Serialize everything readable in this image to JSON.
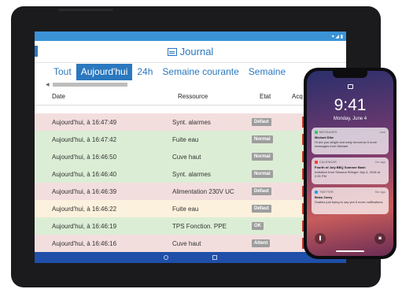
{
  "app": {
    "title": "Journal"
  },
  "tabs": [
    "Tout",
    "Aujourd'hui",
    "24h",
    "Semaine courante",
    "Semaine"
  ],
  "active_tab": 1,
  "table": {
    "headers": {
      "date": "Date",
      "resource": "Ressource",
      "state": "Etat",
      "ack": "Acq"
    },
    "rows": [
      {
        "date": "Aujourd'hui, à 16:47:49",
        "resource": "Synt. alarmes",
        "state": "Défaut",
        "bg": "#f3dede",
        "ack": true
      },
      {
        "date": "Aujourd'hui, à 16:47:42",
        "resource": "Fuite eau",
        "state": "Normal",
        "bg": "#dbeed5",
        "ack": true
      },
      {
        "date": "Aujourd'hui, à 16:46:50",
        "resource": "Cuve haut",
        "state": "Normal",
        "bg": "#dbeed5",
        "ack": true
      },
      {
        "date": "Aujourd'hui, à 16:46:40",
        "resource": "Synt. alarmes",
        "state": "Normal",
        "bg": "#dbeed5",
        "ack": true
      },
      {
        "date": "Aujourd'hui, à 16:46:39",
        "resource": "Alimentation 230V UC",
        "state": "Défaut",
        "bg": "#f3dede",
        "ack": true
      },
      {
        "date": "Aujourd'hui, à 16:46:22",
        "resource": "Fuite eau",
        "state": "Défaut",
        "bg": "#fbf1dc",
        "ack": true
      },
      {
        "date": "Aujourd'hui, à 16:46:19",
        "resource": "TPS Fonction. PPE",
        "state": "OK",
        "bg": "#dbeed5",
        "ack": true
      },
      {
        "date": "Aujourd'hui, à 16:46:16",
        "resource": "Cuve haut",
        "state": "Attent",
        "bg": "#f3dede",
        "ack": true
      }
    ]
  },
  "phone": {
    "time": "9:41",
    "date": "Monday, June 4",
    "notifications": [
      {
        "app": "MESSAGES",
        "color": "#34c759",
        "ago": "now",
        "title": "Michael Dike",
        "body": "Hi are you alright and early tomorrow 5 more messages from Michael"
      },
      {
        "app": "CALENDAR",
        "color": "#ff3b30",
        "ago": "2m ago",
        "title": "Fourth of July BBQ Summer Bash",
        "body": "Invitation from Shawna Stringer July 4, 2018 at 2:00 PM"
      },
      {
        "app": "TWITTER",
        "color": "#1da1f2",
        "ago": "5m ago",
        "title": "Brian Carey",
        "body": "Snakes just trying to say yes 5 more notifications"
      }
    ]
  }
}
